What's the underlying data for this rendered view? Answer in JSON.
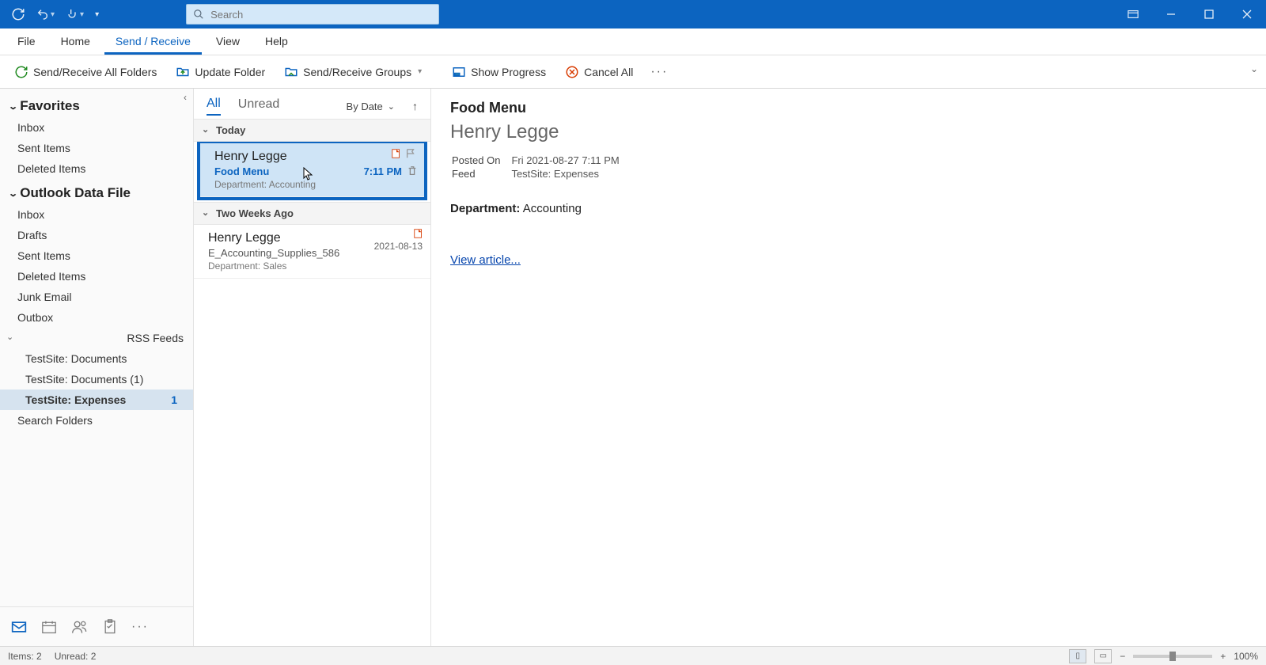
{
  "titlebar": {
    "search_placeholder": "Search"
  },
  "menu": {
    "tabs": [
      "File",
      "Home",
      "Send / Receive",
      "View",
      "Help"
    ],
    "active": 2
  },
  "ribbon": {
    "send_receive_all": "Send/Receive All Folders",
    "update_folder": "Update Folder",
    "send_receive_groups": "Send/Receive Groups",
    "show_progress": "Show Progress",
    "cancel_all": "Cancel All"
  },
  "nav": {
    "sections": [
      {
        "title": "Favorites",
        "items": [
          {
            "label": "Inbox"
          },
          {
            "label": "Sent Items"
          },
          {
            "label": "Deleted Items"
          }
        ]
      },
      {
        "title": "Outlook Data File",
        "items": [
          {
            "label": "Inbox"
          },
          {
            "label": "Drafts"
          },
          {
            "label": "Sent Items"
          },
          {
            "label": "Deleted Items"
          },
          {
            "label": "Junk Email"
          },
          {
            "label": "Outbox"
          },
          {
            "label": "RSS Feeds",
            "expandable": true
          },
          {
            "label": "TestSite: Documents",
            "sub": true
          },
          {
            "label": "TestSite: Documents (1)",
            "sub": true
          },
          {
            "label": "TestSite: Expenses",
            "sub": true,
            "selected": true,
            "count": "1"
          },
          {
            "label": "Search Folders"
          }
        ]
      }
    ]
  },
  "msglist": {
    "tabs": {
      "all": "All",
      "unread": "Unread"
    },
    "sort": "By Date",
    "groups": [
      {
        "label": "Today",
        "items": [
          {
            "from": "Henry Legge",
            "subject": "Food Menu",
            "preview": "Department: Accounting",
            "date": "7:11 PM",
            "selected": true,
            "unread": true
          }
        ]
      },
      {
        "label": "Two Weeks Ago",
        "items": [
          {
            "from": "Henry Legge",
            "subject": "E_Accounting_Supplies_586",
            "preview": "Department: Sales",
            "date": "2021-08-13"
          }
        ]
      }
    ]
  },
  "reading": {
    "title": "Food Menu",
    "from": "Henry Legge",
    "posted_on_label": "Posted On",
    "posted_on": "Fri 2021-08-27 7:11 PM",
    "feed_label": "Feed",
    "feed": "TestSite: Expenses",
    "body_label": "Department:",
    "body_value": "Accounting",
    "link": "View article..."
  },
  "status": {
    "items": "Items: 2",
    "unread": "Unread: 2",
    "zoom": "100%"
  }
}
